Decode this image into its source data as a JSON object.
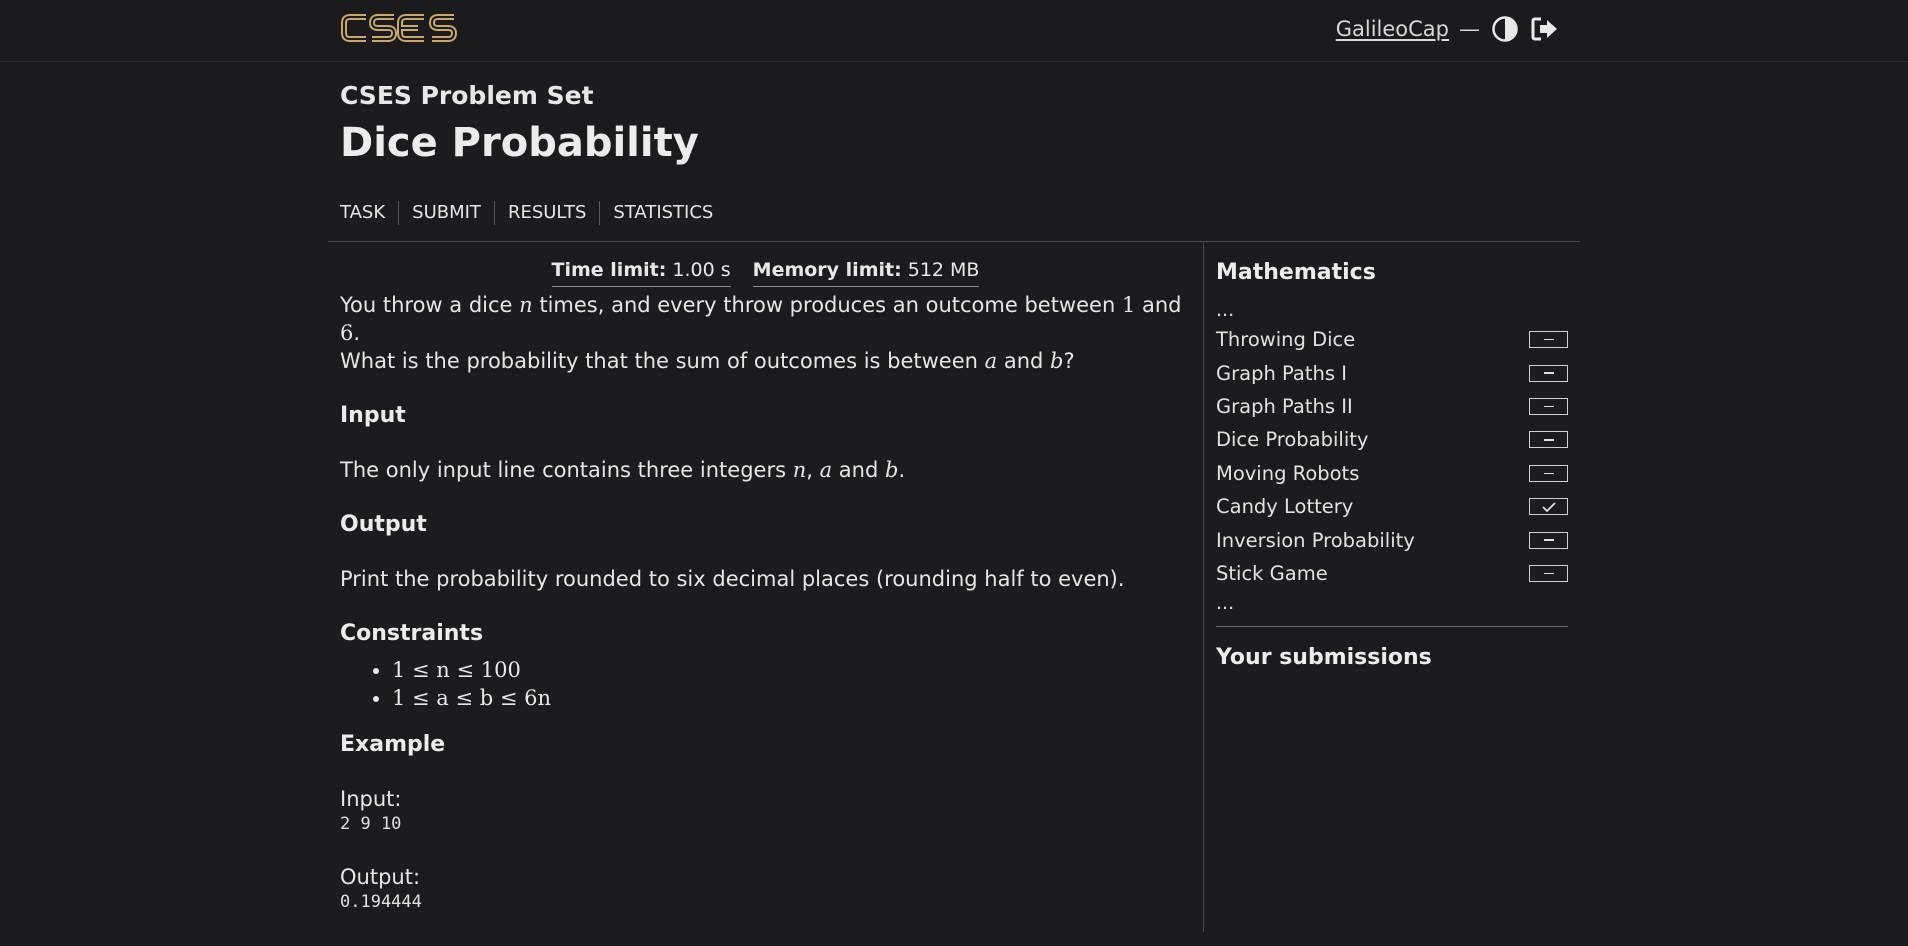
{
  "header": {
    "logo_text": "CSES",
    "username": "GalileoCap",
    "separator": "—",
    "icons": {
      "theme": "contrast-icon",
      "logout": "logout-icon"
    }
  },
  "page": {
    "set_title": "CSES Problem Set",
    "title": "Dice Probability"
  },
  "nav": {
    "task": "TASK",
    "submit": "SUBMIT",
    "results": "RESULTS",
    "statistics": "STATISTICS"
  },
  "limits": {
    "time_label": "Time limit:",
    "time_value": "1.00 s",
    "memory_label": "Memory limit:",
    "memory_value": "512 MB"
  },
  "statement": {
    "p1": [
      "You throw a dice ",
      "n",
      " times, and every throw produces an outcome between ",
      "1",
      " and ",
      "6",
      "."
    ],
    "p2": [
      "What is the probability that the sum of outcomes is between ",
      "a",
      " and ",
      "b",
      "?"
    ],
    "input_heading": "Input",
    "input_text": [
      "The only input line contains three integers ",
      "n",
      ", ",
      "a",
      " and ",
      "b",
      "."
    ],
    "output_heading": "Output",
    "output_text": "Print the probability rounded to six decimal places (rounding half to even).",
    "constraints_heading": "Constraints",
    "constraints": [
      "1 ≤ n ≤ 100",
      "1 ≤ a ≤ b ≤ 6n"
    ],
    "example_heading": "Example",
    "example_input_label": "Input:",
    "example_input": "2 9 10",
    "example_output_label": "Output:",
    "example_output": "0.194444"
  },
  "sidebar": {
    "section_title": "Mathematics",
    "ellipsis": "...",
    "tasks": [
      {
        "label": "Throwing Dice",
        "status": "unsolved"
      },
      {
        "label": "Graph Paths I",
        "status": "unsolved"
      },
      {
        "label": "Graph Paths II",
        "status": "unsolved"
      },
      {
        "label": "Dice Probability",
        "status": "unsolved"
      },
      {
        "label": "Moving Robots",
        "status": "unsolved"
      },
      {
        "label": "Candy Lottery",
        "status": "solved"
      },
      {
        "label": "Inversion Probability",
        "status": "unsolved"
      },
      {
        "label": "Stick Game",
        "status": "unsolved"
      }
    ],
    "submissions_title": "Your submissions"
  }
}
